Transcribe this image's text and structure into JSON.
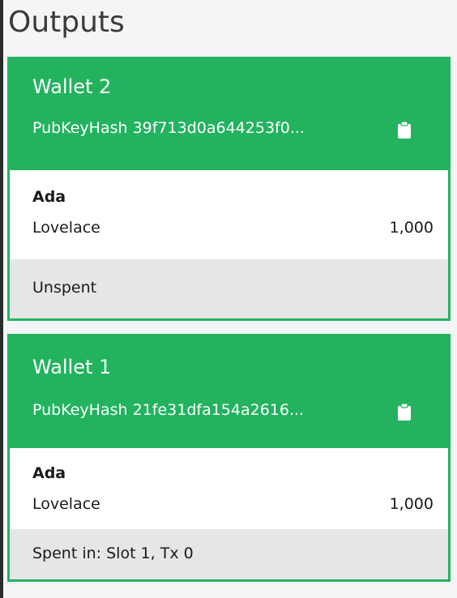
{
  "page": {
    "title": "Outputs",
    "accent_color": "#23b35f"
  },
  "outputs": [
    {
      "wallet": "Wallet 2",
      "pubkey": "PubKeyHash 39f713d0a644253f0...",
      "copy_icon": "clipboard-icon",
      "currency": "Ada",
      "token": "Lovelace",
      "amount": "1,000",
      "status": "Unspent"
    },
    {
      "wallet": "Wallet 1",
      "pubkey": "PubKeyHash 21fe31dfa154a2616...",
      "copy_icon": "clipboard-icon",
      "currency": "Ada",
      "token": "Lovelace",
      "amount": "1,000",
      "status": "Spent in: Slot 1, Tx 0"
    }
  ]
}
